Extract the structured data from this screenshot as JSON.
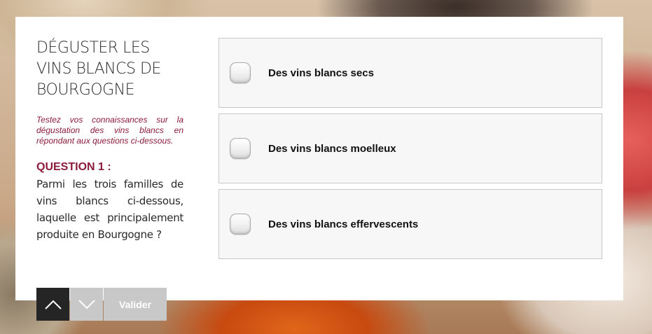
{
  "quiz": {
    "title": "DÉGUSTER LES VINS BLANCS DE BOURGOGNE",
    "intro": "Testez vos connaissances sur la dégustation des vins blancs en répondant aux questions ci-dessous.",
    "question_number": "QUESTION 1 :",
    "question_text": "Parmi les trois familles de vins blancs ci-dessous, laquelle est principalement produite en Bourgogne ?",
    "answers": [
      {
        "label": "Des vins blancs secs",
        "selected": false
      },
      {
        "label": "Des vins blancs moelleux",
        "selected": false
      },
      {
        "label": "Des vins blancs effervescents",
        "selected": false
      }
    ]
  },
  "nav": {
    "up_icon": "chevron-up-icon",
    "down_icon": "chevron-down-icon",
    "validate_label": "Valider"
  },
  "colors": {
    "accent": "#8c1c3b",
    "nav_dark": "#252525",
    "nav_light": "#c8c8c8"
  }
}
